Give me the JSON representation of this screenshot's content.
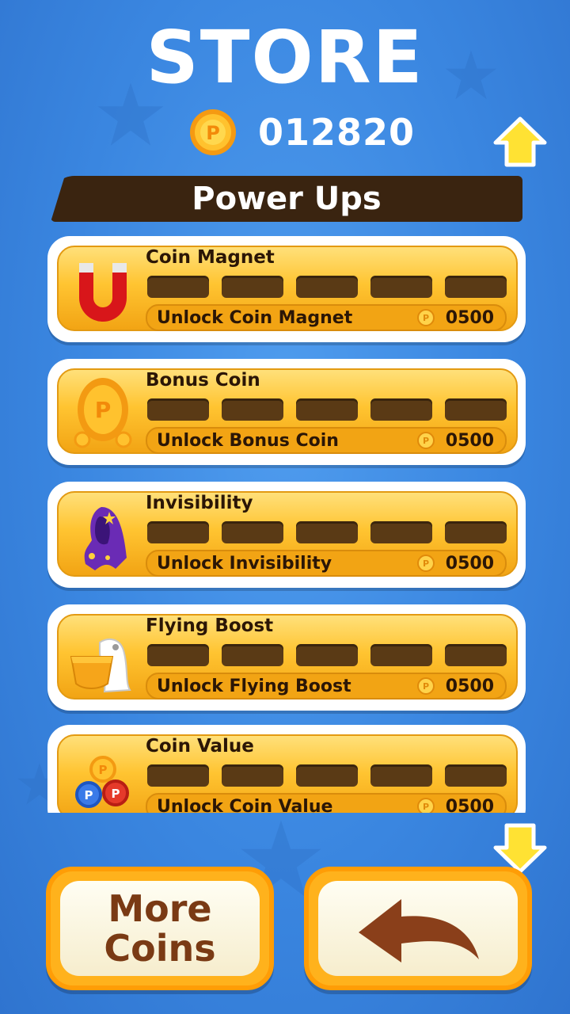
{
  "header": {
    "title": "STORE",
    "coins": "012820"
  },
  "section": {
    "title": "Power Ups"
  },
  "powerups": [
    {
      "name": "Coin Magnet",
      "unlock_label": "Unlock Coin Magnet",
      "price": "0500",
      "icon": "magnet-icon"
    },
    {
      "name": "Bonus Coin",
      "unlock_label": "Unlock Bonus Coin",
      "price": "0500",
      "icon": "bonus-coin-icon"
    },
    {
      "name": "Invisibility",
      "unlock_label": "Unlock Invisibility",
      "price": "0500",
      "icon": "invisibility-cloak-icon"
    },
    {
      "name": "Flying Boost",
      "unlock_label": "Unlock Flying Boost",
      "price": "0500",
      "icon": "flying-boost-icon"
    },
    {
      "name": "Coin Value",
      "unlock_label": "Unlock Coin Value",
      "price": "0500",
      "icon": "coin-value-icon"
    }
  ],
  "buttons": {
    "more_coins": "More Coins"
  },
  "colors": {
    "background": "#3a86e0",
    "card": "#ffc431",
    "banner": "#3a2410",
    "button_text": "#7a3a14"
  }
}
